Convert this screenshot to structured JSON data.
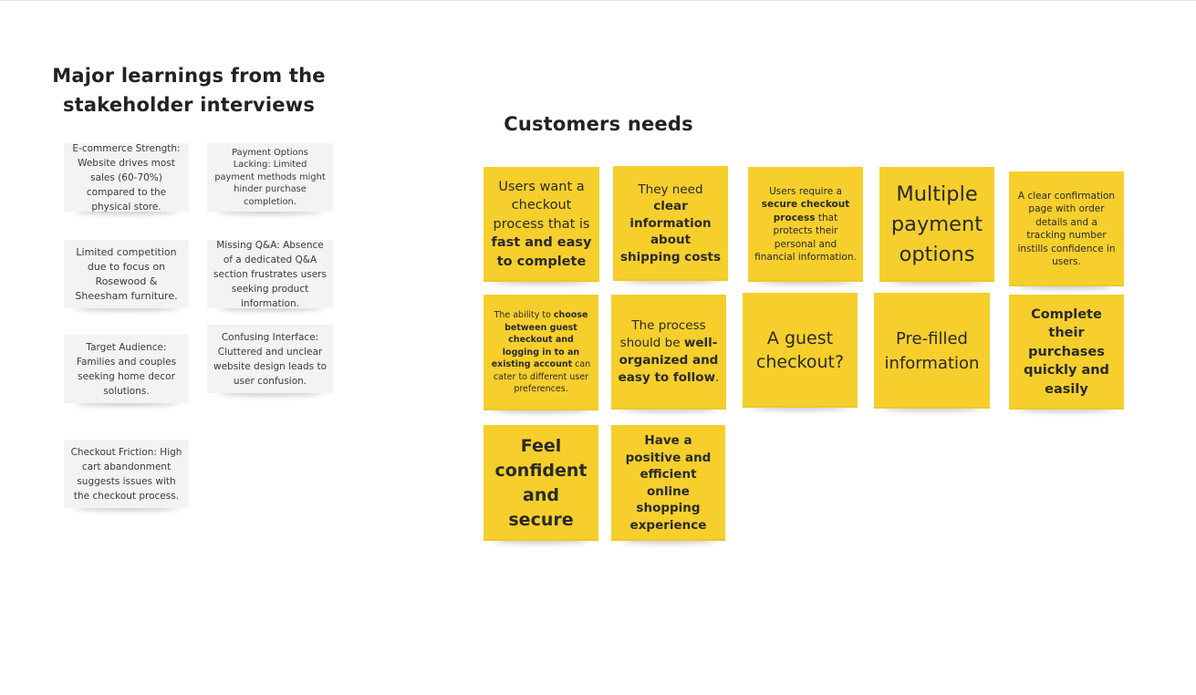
{
  "board": {
    "left_heading": "Major learnings from the stakeholder interviews",
    "right_heading": "Customers needs",
    "learnings": [
      {
        "text": "E-commerce Strength: Website drives most sales (60-70%) compared to the physical store."
      },
      {
        "text": "Payment Options Lacking: Limited payment methods might hinder purchase completion."
      },
      {
        "text": "Limited competition due to focus on Rosewood & Sheesham furniture."
      },
      {
        "text": "Missing Q&A: Absence of a dedicated Q&A section frustrates users seeking product information."
      },
      {
        "text": "Target Audience: Families and couples seeking home decor solutions."
      },
      {
        "text": "Confusing Interface: Cluttered and unclear website design leads to user confusion."
      },
      {
        "text": "Checkout Friction: High cart abandonment suggests issues with the checkout process."
      }
    ],
    "needs": [
      {
        "pre": "Users want a checkout process that is ",
        "bold": "fast and easy to complete",
        "post": ""
      },
      {
        "pre": "They need ",
        "bold": "clear information about shipping costs",
        "post": ""
      },
      {
        "pre": "Users require a ",
        "bold": "secure checkout process",
        "post": " that protects their personal and financial information."
      },
      {
        "pre": "Multiple payment options",
        "bold": "",
        "post": ""
      },
      {
        "pre": "A clear confirmation page with order details and a tracking number instills confidence in users.",
        "bold": "",
        "post": ""
      },
      {
        "pre": "The ability to ",
        "bold": "choose between guest checkout and logging in to an existing account",
        "post": " can cater to different user preferences."
      },
      {
        "pre": "The process should be ",
        "bold": "well-organized and easy to follow",
        "post": "."
      },
      {
        "pre": "A guest checkout?",
        "bold": "",
        "post": ""
      },
      {
        "pre": "Pre-filled information",
        "bold": "",
        "post": ""
      },
      {
        "pre": "",
        "bold": "Complete their purchases quickly and easily",
        "post": ""
      },
      {
        "pre": "",
        "bold": "Feel confident and secure",
        "post": ""
      },
      {
        "pre": "",
        "bold": "Have a positive and efficient online shopping experience",
        "post": ""
      }
    ]
  },
  "colors": {
    "sticky_yellow": "#f6cf2c",
    "sticky_gray": "#f2f3f4",
    "background": "#ffffff"
  }
}
